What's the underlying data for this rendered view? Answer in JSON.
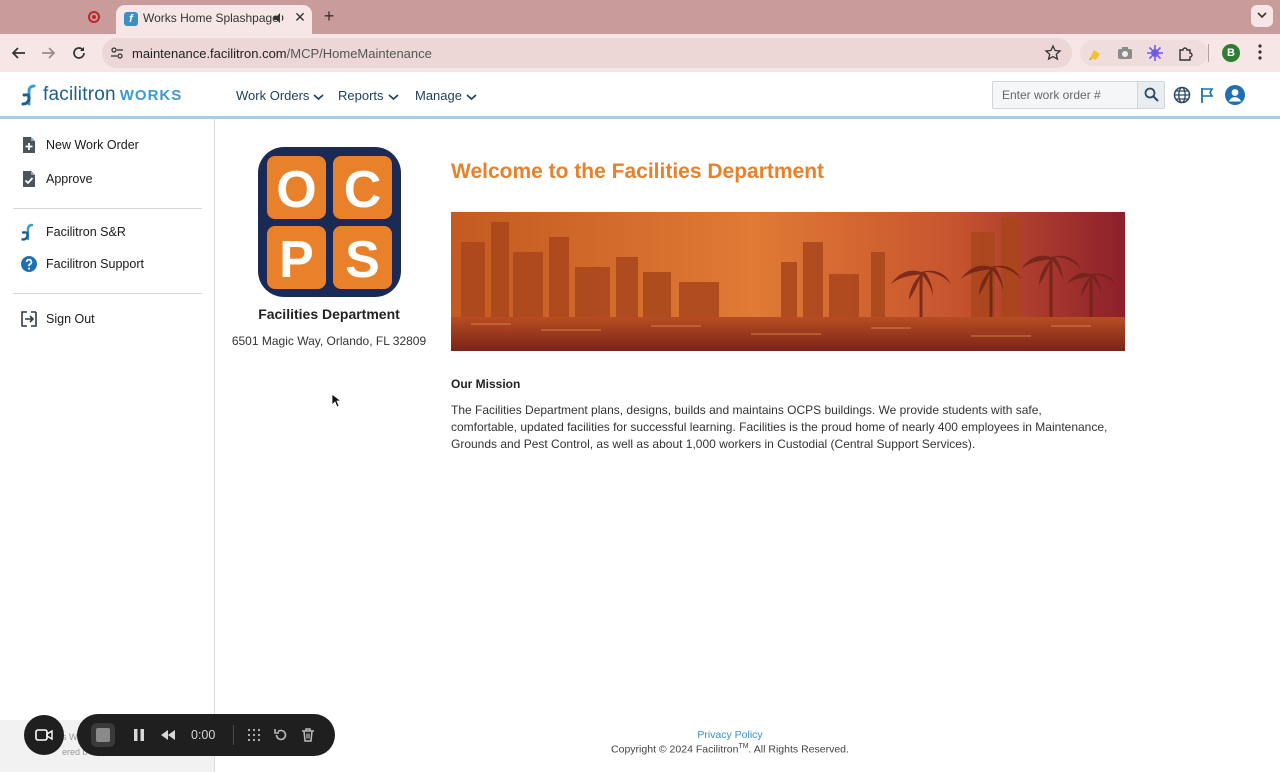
{
  "browser": {
    "tab_title": "Works Home Splashpage",
    "url_host": "maintenance.facilitron.com",
    "url_path": "/MCP/HomeMaintenance",
    "profile_initial": "B",
    "icons": [
      "record-icon",
      "favicon-icon",
      "audio-icon",
      "close-icon",
      "plus-icon",
      "back-icon",
      "forward-icon",
      "reload-icon",
      "site-info-icon",
      "star-icon",
      "extension-icon",
      "camera-icon",
      "puzzle-icon",
      "kebab-icon"
    ]
  },
  "header": {
    "logo_text": "facilitron",
    "logo_works": "WORKS",
    "nav": [
      {
        "label": "Work Orders"
      },
      {
        "label": "Reports"
      },
      {
        "label": "Manage"
      }
    ],
    "search_placeholder": "Enter work order #",
    "icons": [
      "search-icon",
      "globe-icon",
      "flag-icon",
      "user-icon"
    ]
  },
  "sidebar": {
    "items": [
      {
        "label": "New Work Order",
        "icon": "new-document-icon"
      },
      {
        "label": "Approve",
        "icon": "approve-document-icon"
      },
      {
        "label": "Facilitron S&R",
        "icon": "facilitron-icon"
      },
      {
        "label": "Facilitron Support",
        "icon": "help-icon"
      },
      {
        "label": "Sign Out",
        "icon": "sign-out-icon"
      }
    ],
    "footer_line1": "s W",
    "footer_line2": "ered b"
  },
  "org": {
    "logo_letters": [
      "O",
      "C",
      "P",
      "S"
    ],
    "name": "Facilities Department",
    "address": "6501 Magic Way, Orlando, FL  32809"
  },
  "content": {
    "welcome": "Welcome to the Facilities Department",
    "mission_title": "Our Mission",
    "mission_text": "The Facilities Department plans, designs, builds and maintains OCPS buildings. We provide students with safe, comfortable, updated facilities for successful learning. Facilities is the proud home of nearly 400 employees in Maintenance, Grounds and Pest Control, as well as about 1,000 workers in Custodial (Central Support Services)."
  },
  "footer": {
    "privacy": "Privacy Policy",
    "copyright_pre": "Copyright © 2024 Facilitron",
    "copyright_tm": "TM",
    "copyright_post": ". All Rights Reserved."
  },
  "recorder": {
    "time": "0:00"
  },
  "colors": {
    "accent_orange": "#e8812a",
    "brand_blue": "#1d5f8c",
    "works_blue": "#3b9bd0",
    "ocps_navy": "#1b2a55",
    "tab_bar": "#c99b9b"
  }
}
